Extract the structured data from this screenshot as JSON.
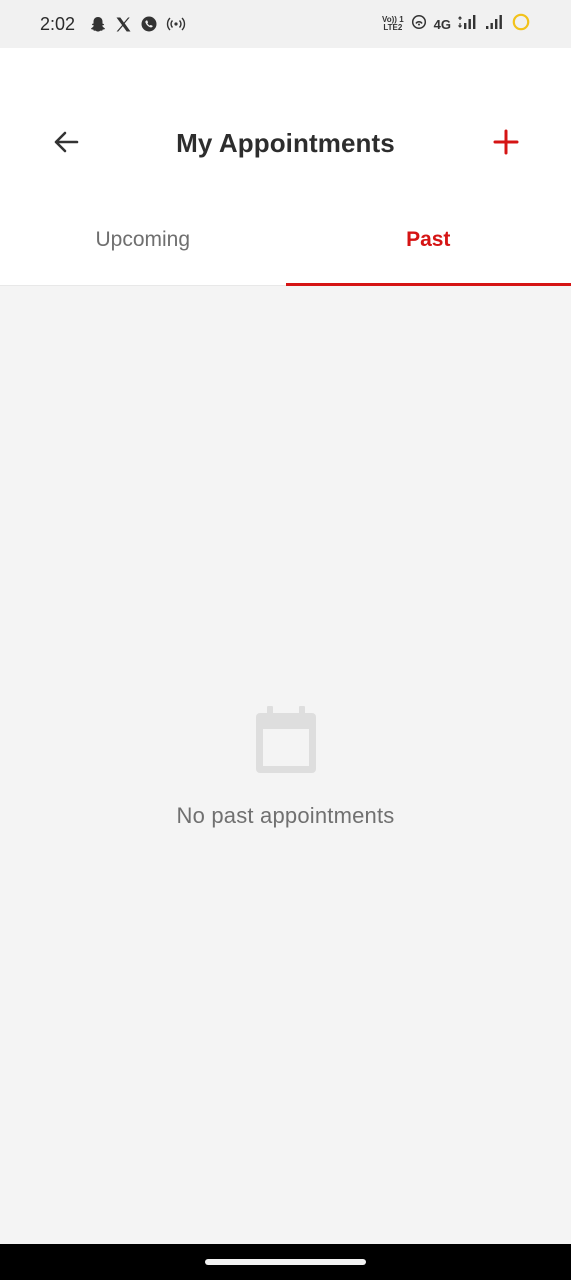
{
  "status_bar": {
    "time": "2:02",
    "left_icons": [
      "snapchat-icon",
      "x-icon",
      "whatsapp-icon",
      "hotspot-icon"
    ],
    "volte_line1": "Vo)) 1",
    "volte_line2": "LTE2",
    "network": "4G",
    "right_icons": [
      "wifi-calling-icon",
      "signal-4g-icon",
      "signal-icon",
      "battery-saver-icon"
    ]
  },
  "header": {
    "title": "My Appointments",
    "back_icon": "arrow-left-icon",
    "add_icon": "plus-icon"
  },
  "tabs": [
    {
      "label": "Upcoming",
      "selected": false
    },
    {
      "label": "Past",
      "selected": true
    }
  ],
  "empty_state": {
    "icon": "calendar-icon",
    "message": "No past appointments"
  },
  "colors": {
    "accent": "#d51414",
    "background": "#f4f4f4",
    "text_dark": "#2d2d2d",
    "text_muted": "#707070"
  }
}
